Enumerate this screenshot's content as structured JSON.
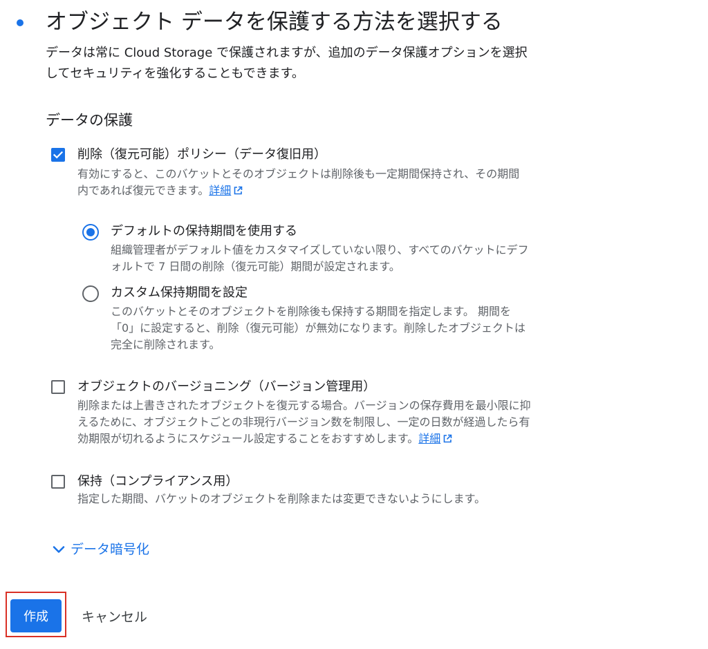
{
  "step": {
    "title": "オブジェクト データを保護する方法を選択する",
    "description": "データは常に Cloud Storage で保護されますが、追加のデータ保護オプションを選択してセキュリティを強化することもできます。"
  },
  "data_protection": {
    "heading": "データの保護",
    "soft_delete": {
      "label": "削除（復元可能）ポリシー（データ復旧用）",
      "checked": true,
      "help": "有効にすると、このバケットとそのオブジェクトは削除後も一定期間保持され、その期間内であれば復元できます。",
      "link": "詳細"
    },
    "retention_options": [
      {
        "label": "デフォルトの保持期間を使用する",
        "selected": true,
        "help": "組織管理者がデフォルト値をカスタマイズしていない限り、すべてのバケットにデフォルトで 7 日間の削除（復元可能）期間が設定されます。"
      },
      {
        "label": "カスタム保持期間を設定",
        "selected": false,
        "help": "このバケットとそのオブジェクトを削除後も保持する期間を指定します。 期間を「0」に設定すると、削除（復元可能）が無効になります。削除したオブジェクトは完全に削除されます。"
      }
    ],
    "versioning": {
      "label": "オブジェクトのバージョニング（バージョン管理用）",
      "checked": false,
      "help": "削除または上書きされたオブジェクトを復元する場合。バージョンの保存費用を最小限に抑えるために、オブジェクトごとの非現行バージョン数を制限し、一定の日数が経過したら有効期限が切れるようにスケジュール設定することをおすすめします。",
      "link": "詳細"
    },
    "retention": {
      "label": "保持（コンプライアンス用）",
      "checked": false,
      "help": "指定した期間、バケットのオブジェクトを削除または変更できないようにします。"
    }
  },
  "encryption": {
    "label": "データ暗号化"
  },
  "actions": {
    "create_label": "作成",
    "cancel_label": "キャンセル"
  },
  "colors": {
    "accent": "#1a73e8",
    "highlight": "#d93025",
    "text": "#202124",
    "secondary_text": "#5f6368"
  }
}
